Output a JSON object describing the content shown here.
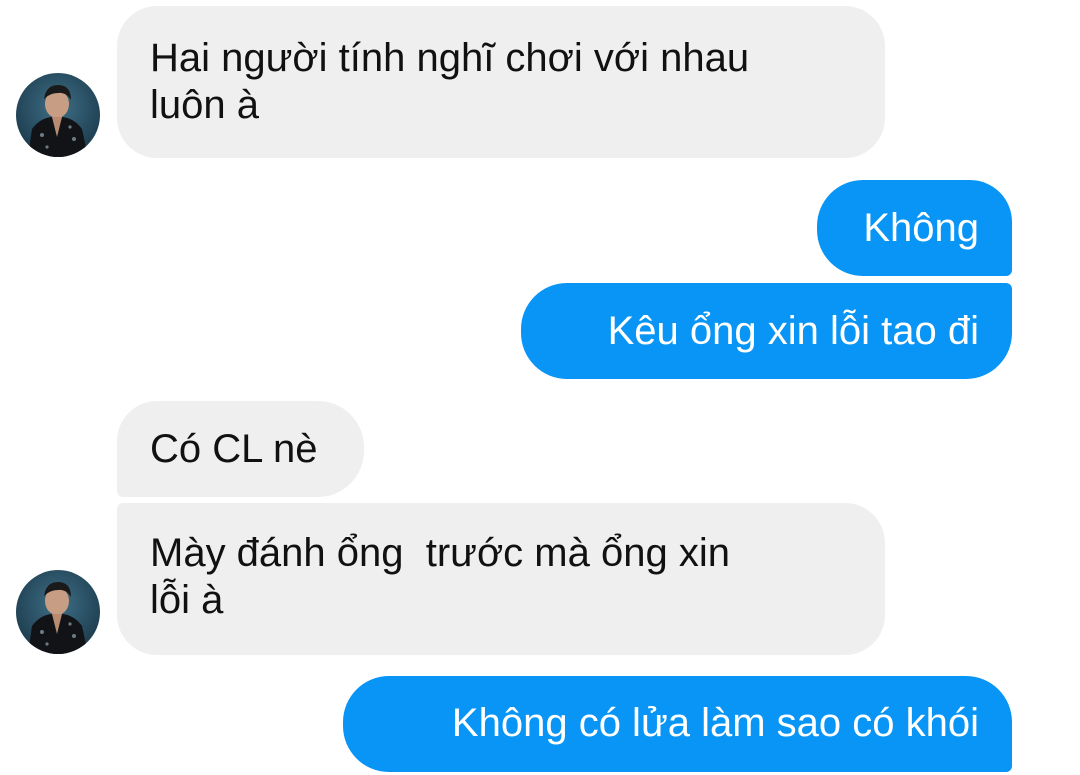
{
  "messages": [
    {
      "id": "m1",
      "direction": "incoming",
      "text": "Hai người tính nghĩ chơi với nhau\nluôn à",
      "has_avatar": true
    },
    {
      "id": "m2",
      "direction": "outgoing",
      "text": "Không"
    },
    {
      "id": "m3",
      "direction": "outgoing",
      "text": "Kêu ổng xin lỗi tao đi"
    },
    {
      "id": "m4",
      "direction": "incoming",
      "text": "Có CL nè"
    },
    {
      "id": "m5",
      "direction": "incoming",
      "text": "Mày đánh ổng  trước mà ổng xin\nlỗi à",
      "has_avatar": true
    },
    {
      "id": "m6",
      "direction": "outgoing",
      "text": "Không có lửa làm sao có khói"
    }
  ],
  "colors": {
    "incoming_bubble": "#efefef",
    "outgoing_bubble": "#0895f6",
    "incoming_text": "#111111",
    "outgoing_text": "#ffffff",
    "background": "#ffffff"
  },
  "icons": {
    "avatar": "contact-avatar-photo"
  }
}
